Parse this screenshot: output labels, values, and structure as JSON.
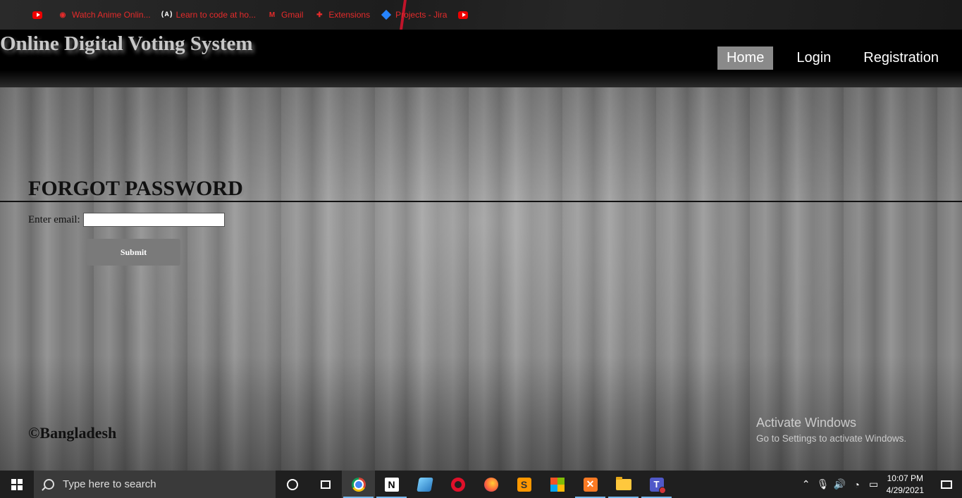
{
  "bookmarks": [
    {
      "label": "",
      "icon": "youtube-icon"
    },
    {
      "label": "Watch Anime Onlin...",
      "icon": "crunchyroll-icon"
    },
    {
      "label": "Learn to code at ho...",
      "icon": "freecodecamp-icon"
    },
    {
      "label": "Gmail",
      "icon": "gmail-icon"
    },
    {
      "label": "Extensions",
      "icon": "puzzle-icon"
    },
    {
      "label": "Projects - Jira",
      "icon": "jira-icon"
    },
    {
      "label": "",
      "icon": "youtube-icon"
    }
  ],
  "header": {
    "site_title": "Online Digital Voting System",
    "nav": [
      {
        "label": "Home",
        "active": true
      },
      {
        "label": "Login",
        "active": false
      },
      {
        "label": "Registration",
        "active": false
      }
    ]
  },
  "form": {
    "title": "FORGOT PASSWORD",
    "email_label": "Enter email:",
    "email_value": "",
    "submit_label": "Submit"
  },
  "footer": {
    "text": "©Bangladesh"
  },
  "watermark": {
    "line1": "Activate Windows",
    "line2": "Go to Settings to activate Windows."
  },
  "taskbar": {
    "search_placeholder": "Type here to search",
    "apps": [
      "cortana-icon",
      "task-view-icon",
      "chrome-icon",
      "notion-icon",
      "app-icon",
      "opera-icon",
      "firefox-icon",
      "sublime-icon",
      "office-icon",
      "xampp-icon",
      "file-explorer-icon",
      "teams-icon"
    ],
    "time": "10:07 PM",
    "date": "4/29/2021",
    "colors": {
      "accent": "#76b9ed",
      "bar": "#1f1f1f"
    }
  }
}
